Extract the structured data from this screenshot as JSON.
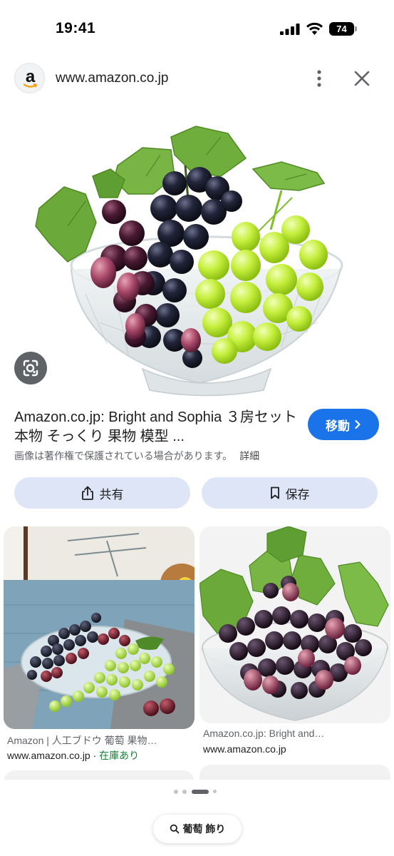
{
  "status_bar": {
    "time": "19:41",
    "battery": "74"
  },
  "header": {
    "url": "www.amazon.co.jp",
    "logo_letter": "a"
  },
  "result": {
    "title": "Amazon.co.jp: Bright and Sophia ３房セット 本物 そっくり 果物 模型 ...",
    "visit_label": "移動",
    "copyright_notice": "画像は著作権で保護されている場合があります。",
    "details_label": "詳細"
  },
  "actions": {
    "share_label": "共有",
    "save_label": "保存"
  },
  "related": [
    {
      "source": "Amazon | 人工ブドウ 葡萄 果物…",
      "domain": "www.amazon.co.jp",
      "availability": "在庫あり"
    },
    {
      "source": "Amazon.co.jp: Bright and…",
      "domain": "www.amazon.co.jp"
    }
  ],
  "search_chip": {
    "label": "葡萄 飾り"
  },
  "colors": {
    "accent": "#1a73e8",
    "action_bg": "#dde5f7",
    "stock_green": "#188038"
  }
}
